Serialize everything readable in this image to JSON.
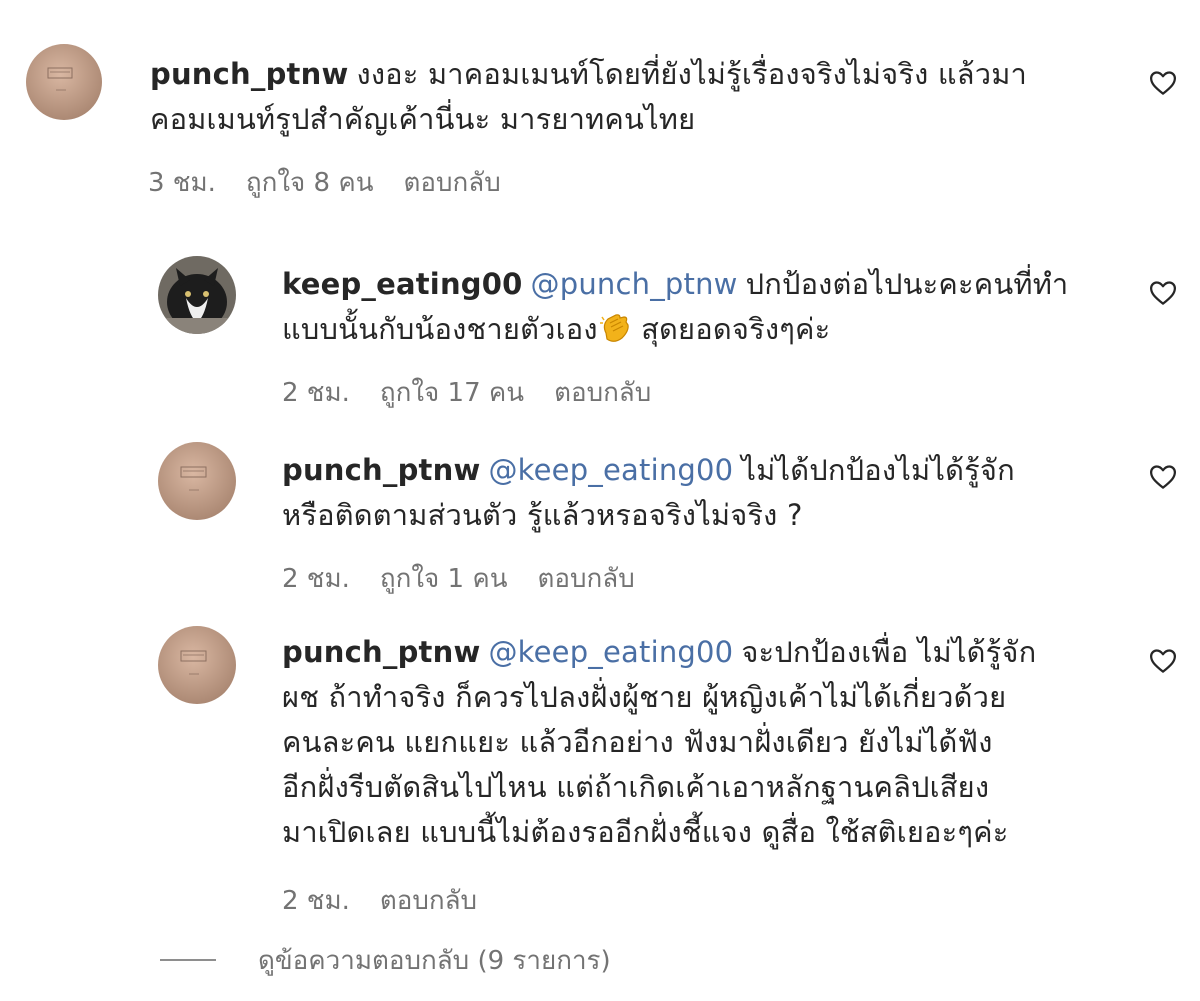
{
  "comments": [
    {
      "username": "punch_ptnw",
      "mention": "",
      "text_line1": "งงอะ มาคอมเมนท์โดยที่ยังไม่รู้เรื่องจริงไม่จริง แล้วมา",
      "text_rest": "คอมเมนท์รูปสำคัญเค้านี่นะ มารยาทคนไทย",
      "time": "3 ชม.",
      "likes": "ถูกใจ 8 คน",
      "reply": "ตอบกลับ"
    },
    {
      "username": "keep_eating00",
      "mention": "@punch_ptnw",
      "text_line1": "ปกป้องต่อไปนะคะคนที่ทำ",
      "text_rest": "แบบนั้นกับน้องชายตัวเอง",
      "text_after_emoji": "สุดยอดจริงๆค่ะ",
      "time": "2 ชม.",
      "likes": "ถูกใจ 17 คน",
      "reply": "ตอบกลับ"
    },
    {
      "username": "punch_ptnw",
      "mention": "@keep_eating00",
      "text_line1": "ไม่ได้ปกป้องไม่ได้รู้จัก",
      "text_rest": "หรือติดตามส่วนตัว รู้แล้วหรอจริงไม่จริง ?",
      "time": "2 ชม.",
      "likes": "ถูกใจ 1 คน",
      "reply": "ตอบกลับ"
    },
    {
      "username": "punch_ptnw",
      "mention": "@keep_eating00",
      "text_line1": "จะปกป้องเพื่อ ไม่ได้รู้จัก",
      "line2": "ผช ถ้าทำจริง ก็ควรไปลงฝั่งผู้ชาย ผู้หญิงเค้าไม่ได้เกี่ยวด้วย",
      "line3": "คนละคน แยกแยะ แล้วอีกอย่าง ฟังมาฝั่งเดียว ยังไม่ได้ฟัง",
      "line4": "อีกฝั่งรีบตัดสินไปไหน แต่ถ้าเกิดเค้าเอาหลักฐานคลิปเสียง",
      "line5": "มาเปิดเลย แบบนี้ไม่ต้องรออีกฝั่งชี้แจง ดูสื่อ ใช้สติเยอะๆค่ะ",
      "time": "2 ชม.",
      "reply": "ตอบกลับ"
    }
  ],
  "view_replies": "ดูข้อความตอบกลับ (9 รายการ)",
  "icons": {
    "like": "heart-outline-icon",
    "emoji": "clapping-hands-emoji"
  }
}
